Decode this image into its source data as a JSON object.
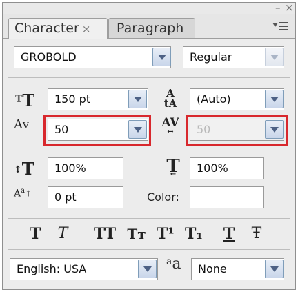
{
  "tabs": [
    {
      "label": "Character",
      "active": true
    },
    {
      "label": "Paragraph",
      "active": false
    }
  ],
  "close_glyph": "×",
  "window_controls": {
    "minimize": "–",
    "close": "×"
  },
  "font": {
    "family": "GROBOLD",
    "style": "Regular"
  },
  "size": {
    "value": "150 pt"
  },
  "leading": {
    "value": "(Auto)"
  },
  "kerning": {
    "value": "50"
  },
  "tracking": {
    "value": "50"
  },
  "vertical_scale": {
    "value": "100%"
  },
  "horizontal_scale": {
    "value": "100%"
  },
  "baseline_shift": {
    "value": "0 pt"
  },
  "color": {
    "label": "Color:",
    "value": "#ffffff"
  },
  "style_buttons": [
    {
      "name": "faux-bold",
      "glyph": "T"
    },
    {
      "name": "faux-italic",
      "glyph": "T"
    },
    {
      "name": "all-caps",
      "glyph": "TT"
    },
    {
      "name": "small-caps",
      "glyph": "Tт"
    },
    {
      "name": "superscript",
      "glyph": "T¹"
    },
    {
      "name": "subscript",
      "glyph": "T₁"
    },
    {
      "name": "underline",
      "glyph": "T"
    },
    {
      "name": "strikethrough",
      "glyph": "Ŧ"
    }
  ],
  "language": {
    "value": "English: USA"
  },
  "antialias": {
    "icon": "aa",
    "value": "None"
  },
  "highlight_color": "#d8282d"
}
